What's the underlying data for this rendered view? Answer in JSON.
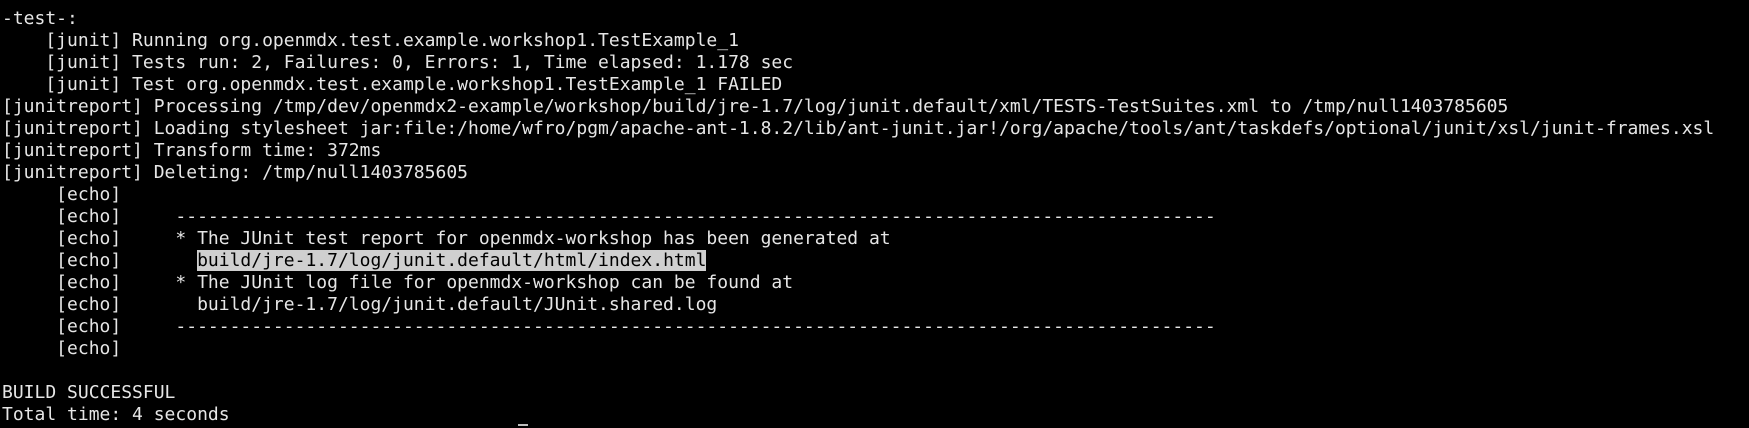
{
  "terminal": {
    "lines": [
      "-test-:",
      "    [junit] Running org.openmdx.test.example.workshop1.TestExample_1",
      "    [junit] Tests run: 2, Failures: 0, Errors: 1, Time elapsed: 1.178 sec",
      "    [junit] Test org.openmdx.test.example.workshop1.TestExample_1 FAILED",
      "[junitreport] Processing /tmp/dev/openmdx2-example/workshop/build/jre-1.7/log/junit.default/xml/TESTS-TestSuites.xml to /tmp/null1403785605",
      "[junitreport] Loading stylesheet jar:file:/home/wfro/pgm/apache-ant-1.8.2/lib/ant-junit.jar!/org/apache/tools/ant/taskdefs/optional/junit/xsl/junit-frames.xsl",
      "[junitreport] Transform time: 372ms",
      "[junitreport] Deleting: /tmp/null1403785605",
      "     [echo]",
      "     [echo]     ------------------------------------------------------------------------------------------------",
      "     [echo]     * The JUnit test report for openmdx-workshop has been generated at",
      "     [echo]       ",
      "     [echo]     * The JUnit log file for openmdx-workshop can be found at",
      "     [echo]       build/jre-1.7/log/junit.default/JUnit.shared.log",
      "     [echo]     ------------------------------------------------------------------------------------------------",
      "     [echo]",
      "",
      "BUILD SUCCESSFUL",
      "Total time: 4 seconds"
    ],
    "selected_text": "build/jre-1.7/log/junit.default/html/index.html"
  },
  "colors": {
    "background": "#000000",
    "foreground": "#e6e6e6",
    "selection_bg": "#cfcfcf",
    "selection_fg": "#000000"
  }
}
